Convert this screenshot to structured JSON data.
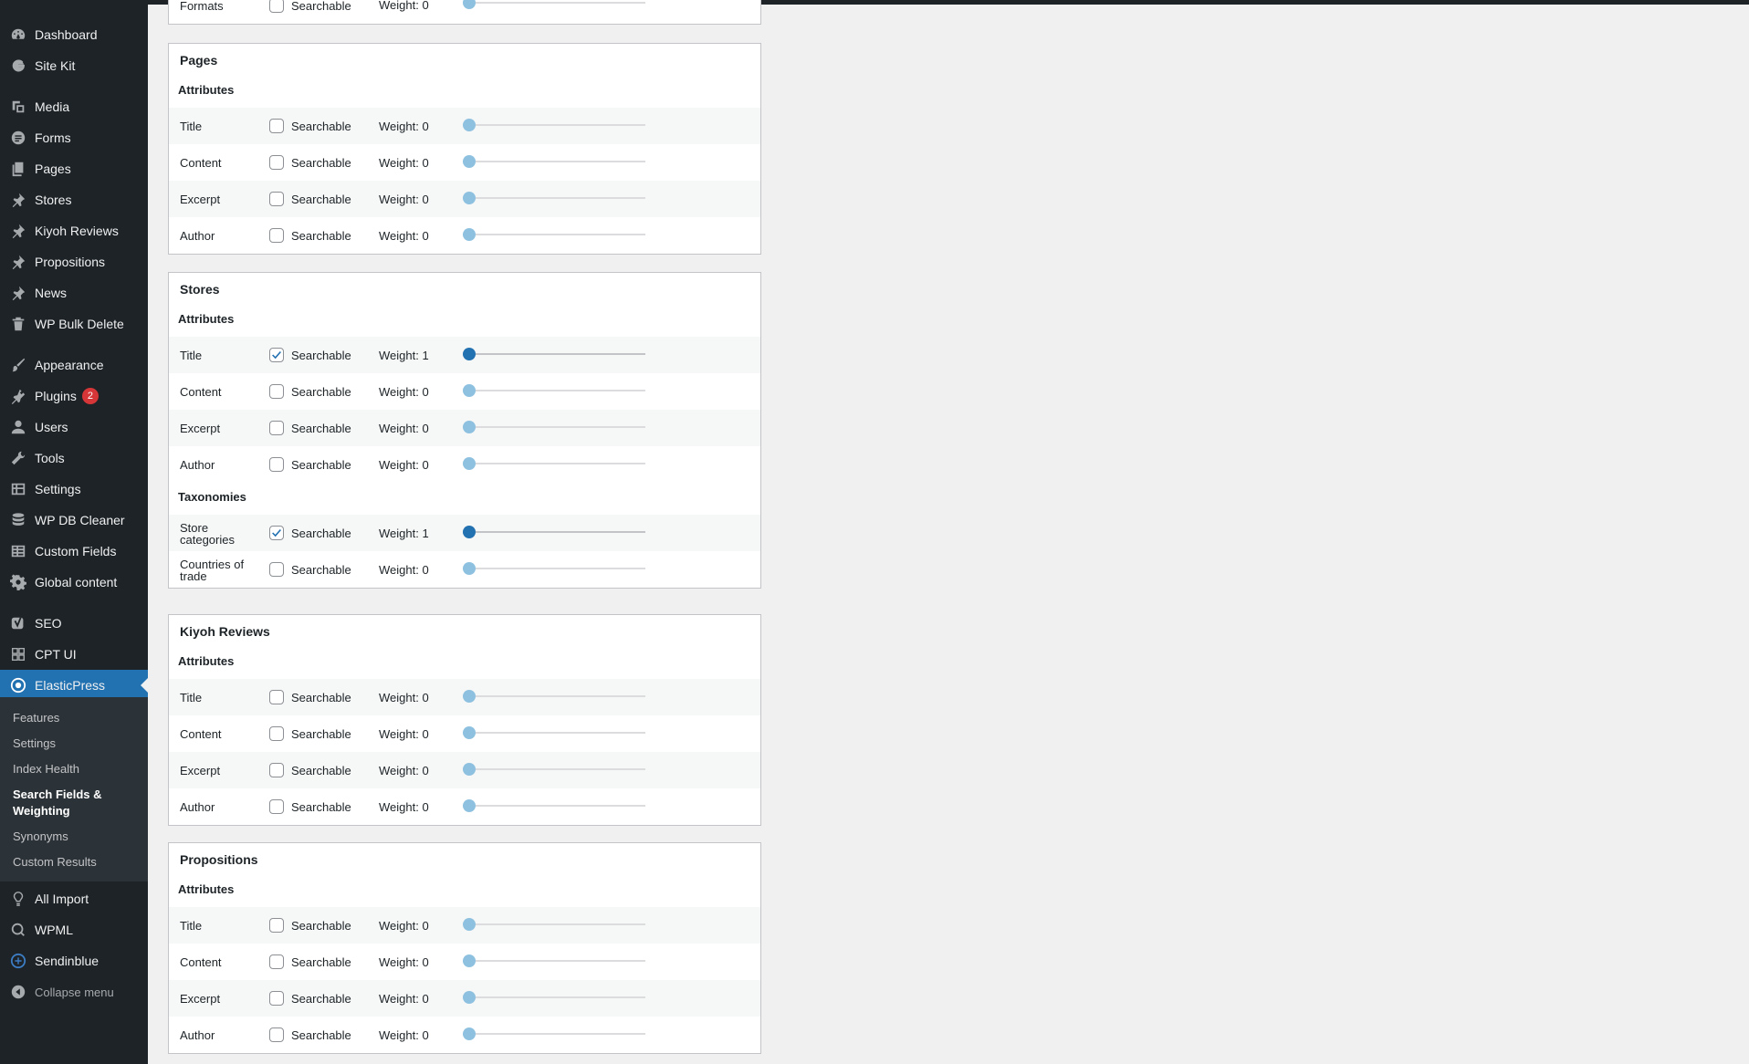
{
  "sidebar": {
    "items": [
      {
        "label": "Dashboard",
        "icon": "dashboard-icon"
      },
      {
        "label": "Site Kit",
        "icon": "google-g-icon"
      },
      {
        "label": "Media",
        "icon": "media-icon"
      },
      {
        "label": "Forms",
        "icon": "forms-icon"
      },
      {
        "label": "Pages",
        "icon": "pages-icon"
      },
      {
        "label": "Stores",
        "icon": "pin-icon"
      },
      {
        "label": "Kiyoh Reviews",
        "icon": "pin-icon"
      },
      {
        "label": "Propositions",
        "icon": "pin-icon"
      },
      {
        "label": "News",
        "icon": "pin-icon"
      },
      {
        "label": "WP Bulk Delete",
        "icon": "trash-icon"
      },
      {
        "label": "Appearance",
        "icon": "brush-icon"
      },
      {
        "label": "Plugins",
        "icon": "plugin-icon",
        "badge": "2"
      },
      {
        "label": "Users",
        "icon": "user-icon"
      },
      {
        "label": "Tools",
        "icon": "wrench-icon"
      },
      {
        "label": "Settings",
        "icon": "settings-icon"
      },
      {
        "label": "WP DB Cleaner",
        "icon": "database-icon"
      },
      {
        "label": "Custom Fields",
        "icon": "grid-icon"
      },
      {
        "label": "Global content",
        "icon": "gear-icon"
      },
      {
        "label": "SEO",
        "icon": "yoast-icon"
      },
      {
        "label": "CPT UI",
        "icon": "cpt-icon"
      },
      {
        "label": "ElasticPress",
        "icon": "elasticpress-icon"
      },
      {
        "label": "All Import",
        "icon": "import-icon"
      },
      {
        "label": "WPML",
        "icon": "wpml-icon"
      },
      {
        "label": "Sendinblue",
        "icon": "sendinblue-icon"
      },
      {
        "label": "Collapse menu",
        "icon": "collapse-icon"
      }
    ],
    "submenu": [
      "Features",
      "Settings",
      "Index Health",
      "Search Fields & Weighting",
      "Synonyms",
      "Custom Results"
    ]
  },
  "common": {
    "searchable": "Searchable",
    "weight_prefix": "Weight:"
  },
  "top_partial": {
    "name": "Formats",
    "weight": "Weight: 0"
  },
  "panels": [
    {
      "title": "Pages",
      "sections": [
        {
          "label": "Attributes",
          "rows": [
            {
              "name": "Title",
              "checked": false,
              "weight": "Weight: 0"
            },
            {
              "name": "Content",
              "checked": false,
              "weight": "Weight: 0"
            },
            {
              "name": "Excerpt",
              "checked": false,
              "weight": "Weight: 0"
            },
            {
              "name": "Author",
              "checked": false,
              "weight": "Weight: 0"
            }
          ]
        }
      ]
    },
    {
      "title": "Stores",
      "sections": [
        {
          "label": "Attributes",
          "rows": [
            {
              "name": "Title",
              "checked": true,
              "weight": "Weight: 1"
            },
            {
              "name": "Content",
              "checked": false,
              "weight": "Weight: 0"
            },
            {
              "name": "Excerpt",
              "checked": false,
              "weight": "Weight: 0"
            },
            {
              "name": "Author",
              "checked": false,
              "weight": "Weight: 0"
            }
          ]
        },
        {
          "label": "Taxonomies",
          "rows": [
            {
              "name": "Store categories",
              "checked": true,
              "weight": "Weight: 1"
            },
            {
              "name": "Countries of trade",
              "checked": false,
              "weight": "Weight: 0"
            }
          ]
        }
      ]
    },
    {
      "title": "Kiyoh Reviews",
      "sections": [
        {
          "label": "Attributes",
          "rows": [
            {
              "name": "Title",
              "checked": false,
              "weight": "Weight: 0"
            },
            {
              "name": "Content",
              "checked": false,
              "weight": "Weight: 0"
            },
            {
              "name": "Excerpt",
              "checked": false,
              "weight": "Weight: 0"
            },
            {
              "name": "Author",
              "checked": false,
              "weight": "Weight: 0"
            }
          ]
        }
      ]
    },
    {
      "title": "Propositions",
      "sections": [
        {
          "label": "Attributes",
          "rows": [
            {
              "name": "Title",
              "checked": false,
              "weight": "Weight: 0"
            },
            {
              "name": "Content",
              "checked": false,
              "weight": "Weight: 0"
            },
            {
              "name": "Excerpt",
              "checked": false,
              "weight": "Weight: 0"
            },
            {
              "name": "Author",
              "checked": false,
              "weight": "Weight: 0"
            }
          ]
        }
      ]
    }
  ]
}
